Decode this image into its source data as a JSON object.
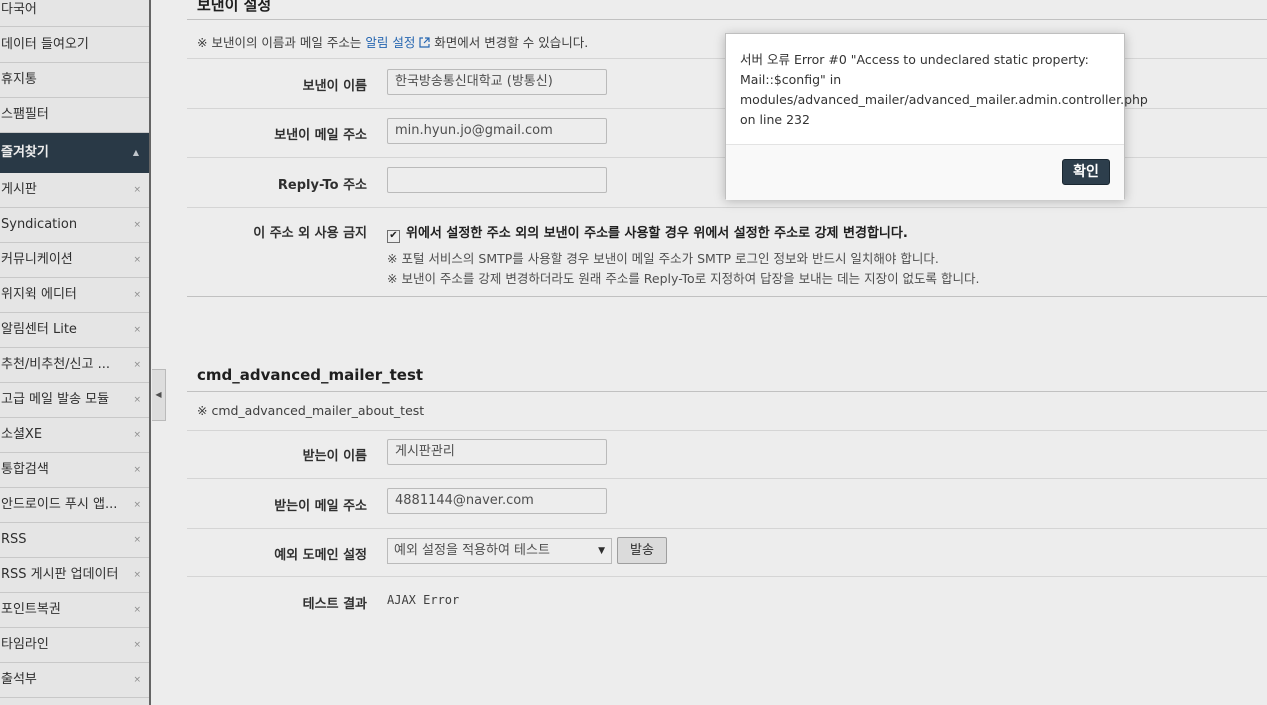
{
  "sidebar": {
    "top_items": [
      {
        "label": "다국어"
      },
      {
        "label": "데이터 들여오기"
      },
      {
        "label": "휴지통"
      },
      {
        "label": "스팸필터"
      }
    ],
    "favorites_header": "즐겨찾기",
    "favorites": [
      {
        "label": "게시판",
        "remove": "×"
      },
      {
        "label": "Syndication",
        "remove": "×"
      },
      {
        "label": "커뮤니케이션",
        "remove": "×"
      },
      {
        "label": "위지윅 에디터",
        "remove": "×"
      },
      {
        "label": "알림센터 Lite",
        "remove": "×"
      },
      {
        "label": "추천/비추천/신고 ...",
        "remove": "×"
      },
      {
        "label": "고급 메일 발송 모듈",
        "remove": "×"
      },
      {
        "label": "소셜XE",
        "remove": "×"
      },
      {
        "label": "통합검색",
        "remove": "×"
      },
      {
        "label": "안드로이드 푸시 앱...",
        "remove": "×"
      },
      {
        "label": "RSS",
        "remove": "×"
      },
      {
        "label": "RSS 게시판 업데이터",
        "remove": "×"
      },
      {
        "label": "포인트복권",
        "remove": "×"
      },
      {
        "label": "타임라인",
        "remove": "×"
      },
      {
        "label": "출석부",
        "remove": "×"
      }
    ]
  },
  "sender_section": {
    "title": "보낸이 설정",
    "note_prefix": "※ 보낸이의 이름과 메일 주소는 ",
    "note_link": "알림 설정",
    "note_suffix": " 화면에서 변경할 수 있습니다.",
    "sender_name_label": "보낸이 이름",
    "sender_name_value": "한국방송통신대학교 (방통신)",
    "sender_email_label": "보낸이 메일 주소",
    "sender_email_value": "min.hyun.jo@gmail.com",
    "reply_to_label": "Reply-To 주소",
    "reply_to_value": "",
    "force_label": "이 주소 외 사용 금지",
    "force_checkbox_text": "위에서 설정한 주소 외의 보낸이 주소를 사용할 경우 위에서 설정한 주소로 강제 변경합니다.",
    "force_note_1": "※ 포털 서비스의 SMTP를 사용할 경우 보낸이 메일 주소가 SMTP 로그인 정보와 반드시 일치해야 합니다.",
    "force_note_2": "※ 보낸이 주소를 강제 변경하더라도 원래 주소를 Reply-To로 지정하여 답장을 보내는 데는 지장이 없도록 합니다."
  },
  "test_section": {
    "title": "cmd_advanced_mailer_test",
    "note": "※ cmd_advanced_mailer_about_test",
    "recipient_name_label": "받는이 이름",
    "recipient_name_value": "게시판관리",
    "recipient_email_label": "받는이 메일 주소",
    "recipient_email_value": "4881144@naver.com",
    "exception_domain_label": "예외 도메인 설정",
    "exception_domain_selected": "예외 설정을 적용하여 테스트",
    "send_button": "발송",
    "result_label": "테스트 결과",
    "result_value": "AJAX Error"
  },
  "modal": {
    "message": "서버 오류 Error #0 \"Access to undeclared static property: Mail::$config\" in modules/advanced_mailer/advanced_mailer.admin.controller.php on line 232",
    "confirm_button": "확인"
  },
  "icons": {
    "external_link": "external-link-icon",
    "caret_up": "caret-up-icon",
    "collapse": "chevron-left-icon",
    "select_arrow": "caret-down-icon"
  },
  "colors": {
    "sidebar_header_bg": "#2d3e4c",
    "link": "#2a6fbf",
    "confirm_button_bg": "#2d3e4c"
  }
}
